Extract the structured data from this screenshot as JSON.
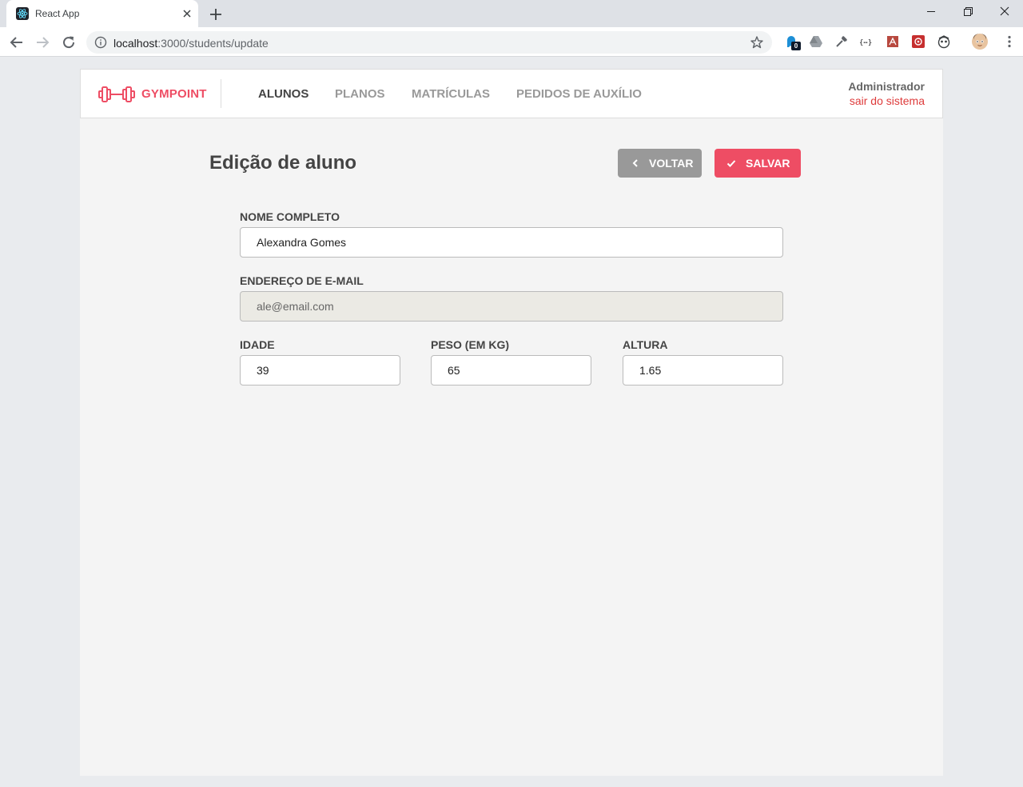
{
  "browser": {
    "tab_title": "React App",
    "url_host": "localhost",
    "url_path": ":3000/students/update",
    "ext_badge": "0"
  },
  "app": {
    "brand": "GYMPOINT",
    "nav": [
      {
        "label": "ALUNOS",
        "active": true
      },
      {
        "label": "PLANOS",
        "active": false
      },
      {
        "label": "MATRÍCULAS",
        "active": false
      },
      {
        "label": "PEDIDOS DE AUXÍLIO",
        "active": false
      }
    ],
    "user": {
      "name": "Administrador",
      "logout_label": "sair do sistema"
    }
  },
  "page": {
    "title": "Edição de aluno",
    "back_label": "VOLTAR",
    "save_label": "SALVAR"
  },
  "form": {
    "name": {
      "label": "NOME COMPLETO",
      "value": "Alexandra Gomes"
    },
    "email": {
      "label": "ENDEREÇO DE E-MAIL",
      "value": "ale@email.com",
      "disabled": true
    },
    "age": {
      "label": "IDADE",
      "value": "39"
    },
    "weight": {
      "label": "PESO (EM KG)",
      "value": "65"
    },
    "height": {
      "label": "ALTURA",
      "value": "1.65"
    }
  },
  "colors": {
    "accent": "#ee4d64",
    "logout": "#de3b3b",
    "back_button": "#999999",
    "page_bg": "#f4f4f4"
  },
  "icons": {
    "favicon": "react-icon",
    "logo": "dumbbell-icon",
    "back": "chevron-left-icon",
    "save": "check-icon"
  }
}
